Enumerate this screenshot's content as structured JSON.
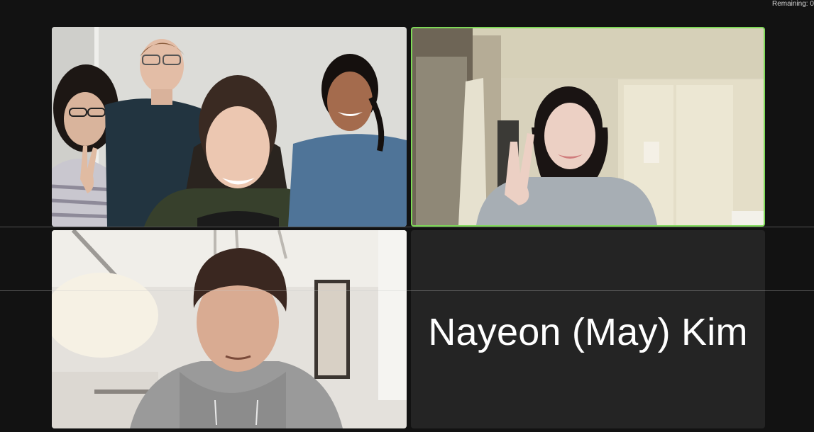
{
  "header": {
    "remaining_label": "Remaining: 0"
  },
  "gallery": {
    "tiles": [
      {
        "type": "video",
        "description": "group-of-four"
      },
      {
        "type": "video",
        "description": "active-speaker",
        "active_speaker": true,
        "highlight_color": "#7ed957"
      },
      {
        "type": "video",
        "description": "single-participant"
      },
      {
        "type": "name",
        "name": "Nayeon (May) Kim"
      }
    ]
  },
  "colors": {
    "background": "#121212",
    "name_tile": "#242424",
    "active_border": "#7ed957",
    "name_text": "#ffffff"
  }
}
